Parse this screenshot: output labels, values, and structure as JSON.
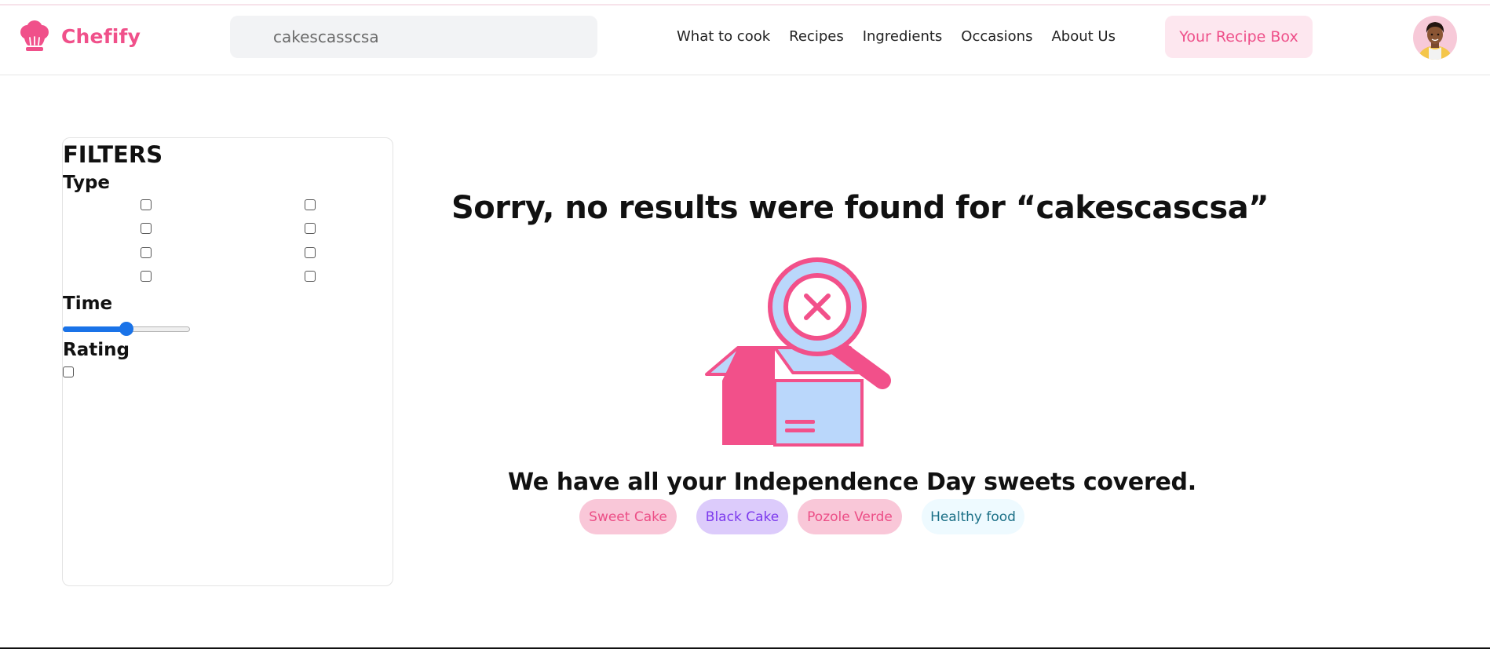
{
  "brand": {
    "name": "Chefify",
    "color": "#f0508a",
    "icon": "chef-hat-icon"
  },
  "search": {
    "value": "cakescasscsa",
    "icon": "search-icon"
  },
  "nav": {
    "items": [
      {
        "label": "What to cook"
      },
      {
        "label": "Recipes"
      },
      {
        "label": "Ingredients"
      },
      {
        "label": "Occasions"
      },
      {
        "label": "About Us"
      }
    ]
  },
  "header": {
    "recipe_box_label": "Your Recipe Box",
    "avatar_icon": "user-avatar"
  },
  "filters": {
    "title": "FILTERS",
    "type_label": "Type",
    "type_checkboxes": [
      false,
      false,
      false,
      false,
      false,
      false,
      false,
      false
    ],
    "time_label": "Time",
    "time_slider_value": 0.5,
    "rating_label": "Rating",
    "rating_checkbox": false
  },
  "results": {
    "message": "Sorry, no results were found for “cakescascsa”",
    "illustration": "empty-box-search-icon",
    "suggestion_heading": "We have all your Independence Day sweets covered.",
    "tags": [
      {
        "label": "Sweet Cake",
        "bg": "#f9c7d8",
        "color": "#ec4e86"
      },
      {
        "label": "Black Cake",
        "bg": "#dccbfb",
        "color": "#7c3aed"
      },
      {
        "label": "Pozole Verde",
        "bg": "#f9c7d8",
        "color": "#ec4e86"
      },
      {
        "label": "Healthy food",
        "bg": "#eefaff",
        "color": "#1a6f86"
      }
    ]
  }
}
